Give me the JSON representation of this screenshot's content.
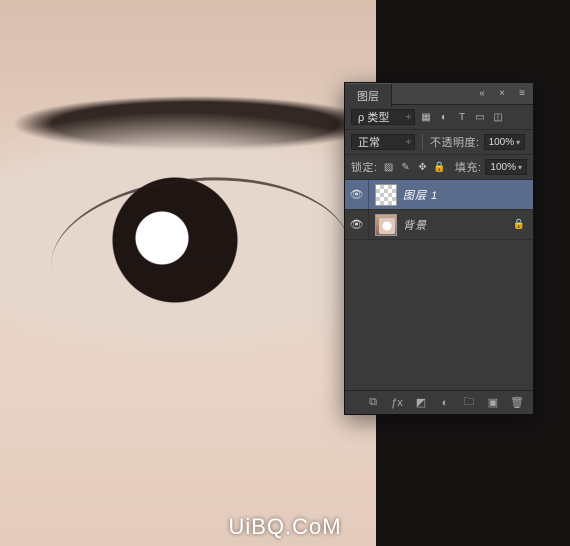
{
  "panel": {
    "title": "图层",
    "filter_label": "ρ 类型",
    "blend_mode": "正常",
    "opacity_label": "不透明度:",
    "opacity_value": "100%",
    "lock_label": "锁定:",
    "fill_label": "填充:",
    "fill_value": "100%"
  },
  "layers": [
    {
      "name": "图层 1",
      "selected": true,
      "thumb": "checker",
      "locked": false
    },
    {
      "name": "背景",
      "selected": false,
      "thumb": "bg",
      "locked": true
    }
  ],
  "icons": {
    "collapse": "«",
    "close": "×",
    "menu": "≡",
    "dropdown": "÷",
    "chev": "▾",
    "filter_image": "▦",
    "filter_adjust": "◐",
    "filter_text": "T",
    "filter_shape": "▭",
    "filter_smart": "◫",
    "lock_trans": "▨",
    "lock_paint": "✎",
    "lock_move": "✥",
    "lock_all": "🔒",
    "eye": "👁",
    "link": "⧉",
    "fx": "ƒx",
    "mask": "◩",
    "adjust": "◐",
    "group": "🗀",
    "new": "▣",
    "trash": "🗑"
  },
  "watermark": "UiBQ.CoM"
}
